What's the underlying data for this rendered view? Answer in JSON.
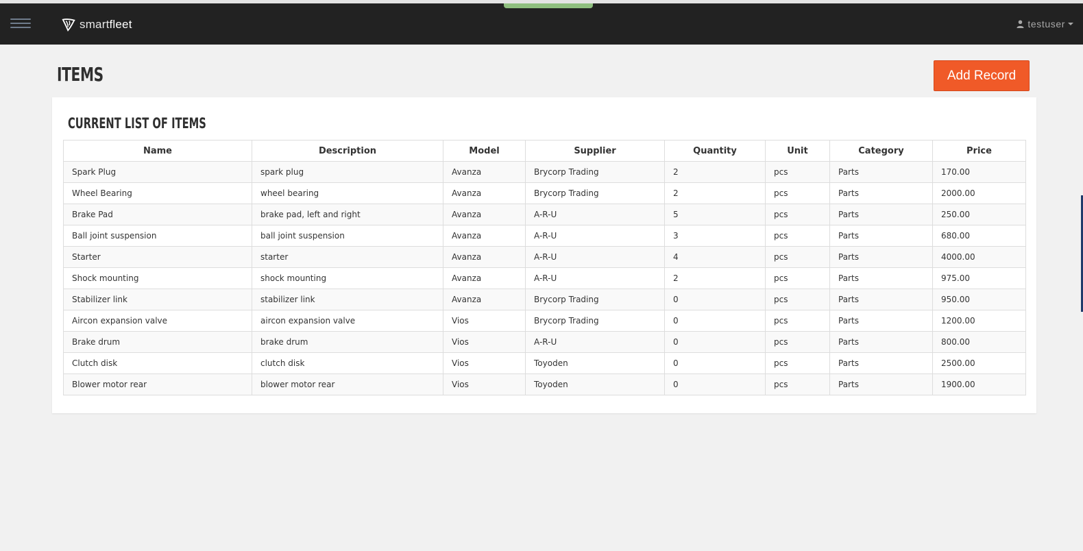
{
  "app": {
    "brand_light": "smart",
    "brand_bold": "fleet",
    "user": "testuser"
  },
  "page": {
    "title": "ITEMS",
    "add_button": "Add Record",
    "panel_title": "CURRENT LIST OF ITEMS"
  },
  "colors": {
    "navbar": "#222222",
    "accent_button": "#f05a28",
    "page_bg": "#f1f1f1"
  },
  "table": {
    "columns": [
      "Name",
      "Description",
      "Model",
      "Supplier",
      "Quantity",
      "Unit",
      "Category",
      "Price"
    ],
    "rows": [
      [
        "Spark Plug",
        "spark plug",
        "Avanza",
        "Brycorp Trading",
        "2",
        "pcs",
        "Parts",
        "170.00"
      ],
      [
        "Wheel Bearing",
        "wheel bearing",
        "Avanza",
        "Brycorp Trading",
        "2",
        "pcs",
        "Parts",
        "2000.00"
      ],
      [
        "Brake Pad",
        "brake pad, left and right",
        "Avanza",
        "A-R-U",
        "5",
        "pcs",
        "Parts",
        "250.00"
      ],
      [
        "Ball joint suspension",
        "ball joint suspension",
        "Avanza",
        "A-R-U",
        "3",
        "pcs",
        "Parts",
        "680.00"
      ],
      [
        "Starter",
        "starter",
        "Avanza",
        "A-R-U",
        "4",
        "pcs",
        "Parts",
        "4000.00"
      ],
      [
        "Shock mounting",
        "shock mounting",
        "Avanza",
        "A-R-U",
        "2",
        "pcs",
        "Parts",
        "975.00"
      ],
      [
        "Stabilizer link",
        "stabilizer link",
        "Avanza",
        "Brycorp Trading",
        "0",
        "pcs",
        "Parts",
        "950.00"
      ],
      [
        "Aircon expansion valve",
        "aircon expansion valve",
        "Vios",
        "Brycorp Trading",
        "0",
        "pcs",
        "Parts",
        "1200.00"
      ],
      [
        "Brake drum",
        "brake drum",
        "Vios",
        "A-R-U",
        "0",
        "pcs",
        "Parts",
        "800.00"
      ],
      [
        "Clutch disk",
        "clutch disk",
        "Vios",
        "Toyoden",
        "0",
        "pcs",
        "Parts",
        "2500.00"
      ],
      [
        "Blower motor rear",
        "blower motor rear",
        "Vios",
        "Toyoden",
        "0",
        "pcs",
        "Parts",
        "1900.00"
      ]
    ]
  }
}
